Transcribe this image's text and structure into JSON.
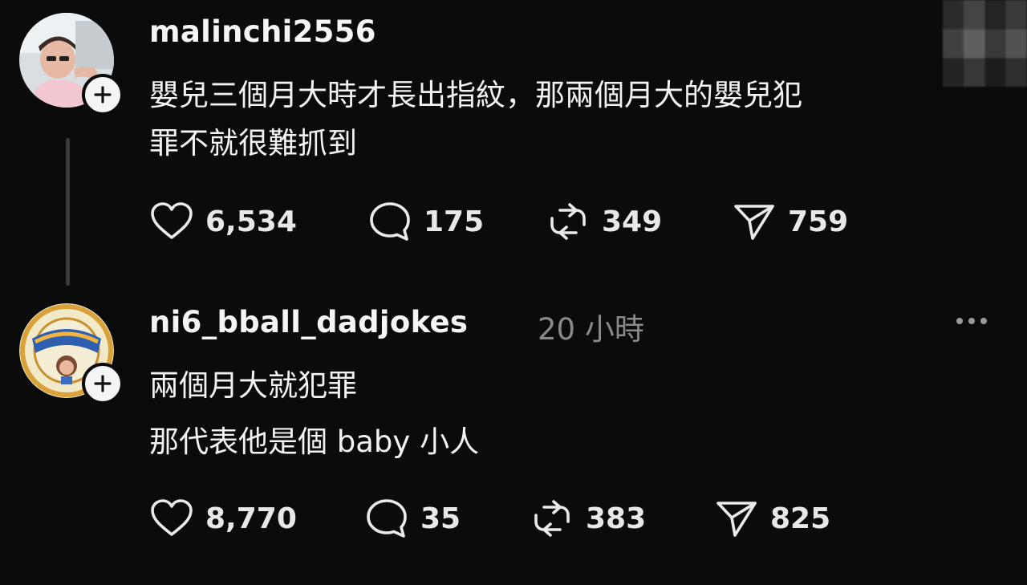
{
  "colors": {
    "background": "#0b0b0b",
    "text": "#f3f3f3",
    "muted": "#8a8a8a",
    "thread_line": "#3a3a3a"
  },
  "posts": [
    {
      "username": "malinchi2556",
      "timestamp": "",
      "lines": [
        "嬰兒三個月大時才長出指紋，那兩個月大的嬰兒犯",
        "罪不就很難抓到"
      ],
      "avatar_icon": "user-photo-avatar",
      "stats": {
        "likes": "6,534",
        "replies": "175",
        "reposts": "349",
        "shares": "759"
      }
    },
    {
      "username": "ni6_bball_dadjokes",
      "timestamp": "20 小時",
      "lines": [
        "兩個月大就犯罪",
        "那代表他是個 baby 小人"
      ],
      "avatar_icon": "team-badge-avatar",
      "stats": {
        "likes": "8,770",
        "replies": "35",
        "reposts": "383",
        "shares": "825"
      }
    }
  ],
  "icons": {
    "like": "heart-icon",
    "reply": "speech-bubble-icon",
    "repost": "repost-icon",
    "share": "send-icon",
    "follow": "plus-icon",
    "more": "more-dots-icon"
  }
}
